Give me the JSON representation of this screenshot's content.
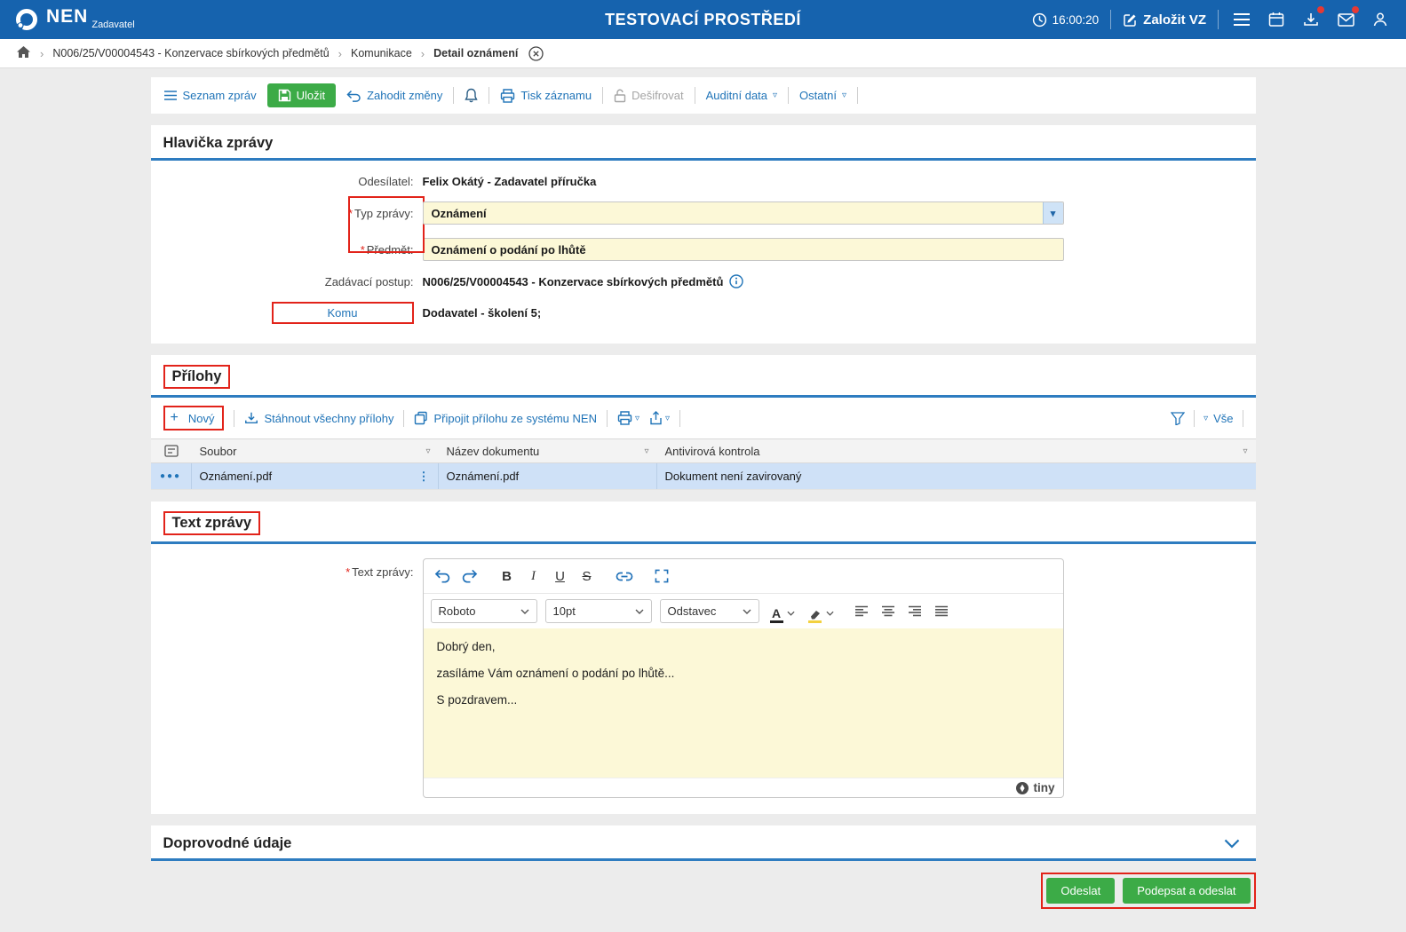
{
  "ui": {
    "required_marker": "*"
  },
  "icons": {
    "chevron_down": "▾",
    "filter_chevron": "▿",
    "breadcrumb_sep": "›",
    "plus": "+",
    "row_menu": "●●●",
    "drag_dots": "⋮",
    "bold": "B",
    "italic": "I",
    "underline": "U",
    "strikethrough": "S",
    "text_color": "A"
  },
  "header": {
    "brand": "NEN",
    "brand_sub": "Zadavatel",
    "env_title": "TESTOVACÍ PROSTŘEDÍ",
    "time": "16:00:20",
    "create_vz_label": "Založit VZ"
  },
  "breadcrumb": {
    "items": [
      "N006/25/V00004543 - Konzervace sbírkových předmětů",
      "Komunikace",
      "Detail oznámení"
    ]
  },
  "toolbar": {
    "message_list_label": "Seznam zpráv",
    "save_label": "Uložit",
    "discard_label": "Zahodit změny",
    "print_label": "Tisk záznamu",
    "decrypt_label": "Dešifrovat",
    "audit_label": "Auditní data",
    "other_label": "Ostatní"
  },
  "message_header": {
    "section_title": "Hlavička zprávy",
    "sender_label": "Odesílatel:",
    "sender_value": "Felix Okátý - Zadavatel příručka",
    "type_label": "Typ zprávy:",
    "type_value": "Oznámení",
    "subject_label": "Předmět:",
    "subject_value": "Oznámení o podání po lhůtě",
    "procedure_label": "Zadávací postup:",
    "procedure_value": "N006/25/V00004543 - Konzervace sbírkových předmětů",
    "recipient_label": "Komu",
    "recipient_value": "Dodavatel - školení 5;"
  },
  "attachments": {
    "section_title": "Přílohy",
    "new_label": "Nový",
    "download_all_label": "Stáhnout všechny přílohy",
    "attach_from_nen_label": "Připojit přílohu ze systému NEN",
    "all_filter_label": "Vše",
    "columns": {
      "file": "Soubor",
      "document_name": "Název dokumentu",
      "antivirus": "Antivirová kontrola"
    },
    "row": {
      "file": "Oznámení.pdf",
      "document_name": "Oznámení.pdf",
      "antivirus": "Dokument není zavirovaný"
    }
  },
  "message_text": {
    "section_title": "Text zprávy",
    "field_label": "Text zprávy:",
    "editor": {
      "font_family": "Roboto",
      "font_size": "10pt",
      "block_format": "Odstavec",
      "paragraphs": [
        "Dobrý den,",
        "zasíláme Vám oznámení o podání po lhůtě...",
        "S pozdravem..."
      ],
      "brand": "tiny"
    }
  },
  "additional_section": {
    "section_title": "Doprovodné údaje"
  },
  "footer": {
    "send_label": "Odeslat",
    "sign_send_label": "Podepsat a odeslat"
  }
}
